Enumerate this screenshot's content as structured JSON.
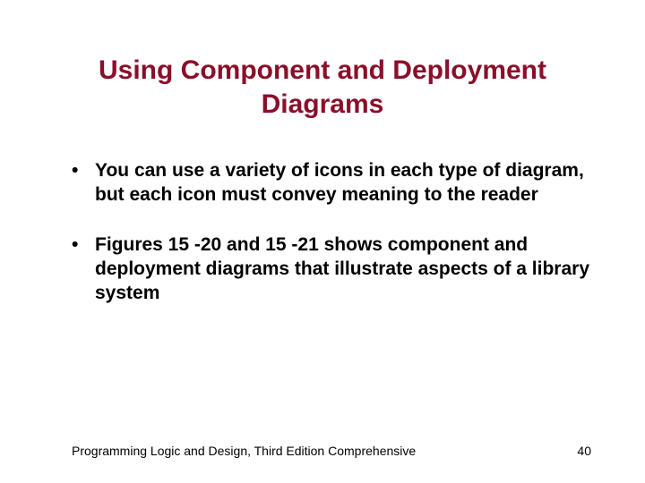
{
  "title": "Using Component and Deployment Diagrams",
  "bullets": [
    "You can use a variety of icons in each type of diagram, but each icon must convey meaning to the reader",
    "Figures 15 -20 and 15 -21 shows component and deployment diagrams that illustrate aspects of a library system"
  ],
  "footer": {
    "text": "Programming Logic and Design, Third Edition Comprehensive",
    "page": "40"
  }
}
